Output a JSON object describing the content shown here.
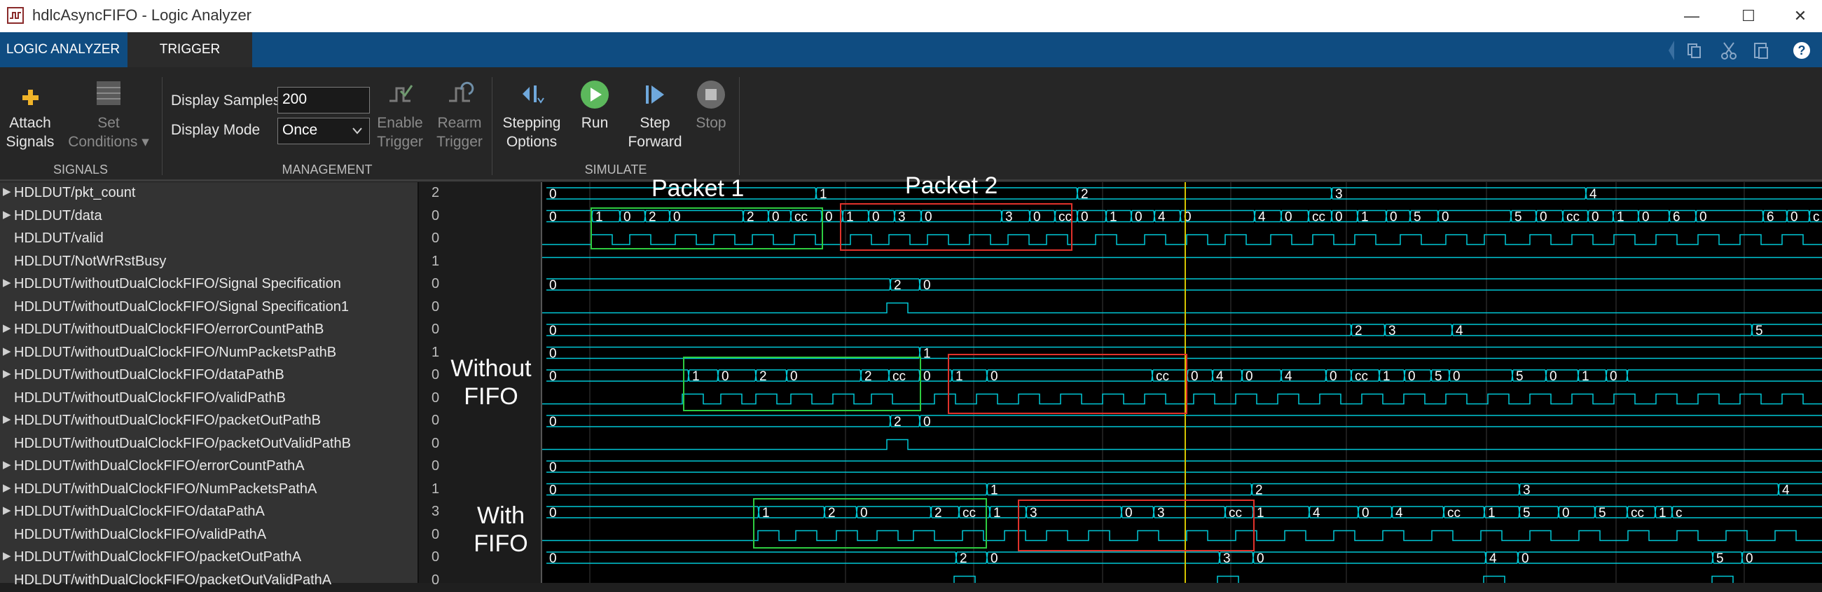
{
  "window": {
    "title": "hdlcAsyncFIFO - Logic Analyzer",
    "app_icon": "logic-analyzer-icon",
    "controls": [
      "minimize-icon",
      "maximize-icon",
      "close-icon"
    ],
    "minimize_glyph": "—",
    "maximize_glyph": "☐",
    "close_glyph": "✕"
  },
  "tabs": [
    {
      "label": "LOGIC ANALYZER",
      "active": false
    },
    {
      "label": "TRIGGER",
      "active": true
    }
  ],
  "quick_access": [
    "copy-icon",
    "cut-icon",
    "paste-icon",
    "help-icon"
  ],
  "toolstrip": {
    "signals": {
      "section_label": "SIGNALS",
      "attach": {
        "line1": "Attach",
        "line2": "Signals"
      },
      "set_conditions": {
        "line1": "Set",
        "line2": "Conditions ▾"
      }
    },
    "management": {
      "section_label": "MANAGEMENT",
      "display_samples_label": "Display Samples",
      "display_samples_value": "200",
      "display_mode_label": "Display Mode",
      "display_mode_value": "Once",
      "enable_trigger": {
        "line1": "Enable",
        "line2": "Trigger"
      },
      "rearm_trigger": {
        "line1": "Rearm",
        "line2": "Trigger"
      }
    },
    "simulate": {
      "section_label": "SIMULATE",
      "stepping": {
        "line1": "Stepping",
        "line2": "Options"
      },
      "run": {
        "line1": "Run"
      },
      "step_forward": {
        "line1": "Step",
        "line2": "Forward"
      },
      "stop": {
        "line1": "Stop"
      }
    }
  },
  "signals": [
    {
      "name": "HDLDUT/pkt_count",
      "value": "2",
      "expand": true
    },
    {
      "name": "HDLDUT/data",
      "value": "0",
      "expand": true
    },
    {
      "name": "HDLDUT/valid",
      "value": "0",
      "expand": false
    },
    {
      "name": "HDLDUT/NotWrRstBusy",
      "value": "1",
      "expand": false
    },
    {
      "name": "HDLDUT/withoutDualClockFIFO/Signal Specification",
      "value": "0",
      "expand": true
    },
    {
      "name": "HDLDUT/withoutDualClockFIFO/Signal Specification1",
      "value": "0",
      "expand": false
    },
    {
      "name": "HDLDUT/withoutDualClockFIFO/errorCountPathB",
      "value": "0",
      "expand": true
    },
    {
      "name": "HDLDUT/withoutDualClockFIFO/NumPacketsPathB",
      "value": "1",
      "expand": true
    },
    {
      "name": "HDLDUT/withoutDualClockFIFO/dataPathB",
      "value": "0",
      "expand": true
    },
    {
      "name": "HDLDUT/withoutDualClockFIFO/validPathB",
      "value": "0",
      "expand": false
    },
    {
      "name": "HDLDUT/withoutDualClockFIFO/packetOutPathB",
      "value": "0",
      "expand": true
    },
    {
      "name": "HDLDUT/withoutDualClockFIFO/packetOutValidPathB",
      "value": "0",
      "expand": false
    },
    {
      "name": "HDLDUT/withDualClockFIFO/errorCountPathA",
      "value": "0",
      "expand": true
    },
    {
      "name": "HDLDUT/withDualClockFIFO/NumPacketsPathA",
      "value": "1",
      "expand": true
    },
    {
      "name": "HDLDUT/withDualClockFIFO/dataPathA",
      "value": "3",
      "expand": true
    },
    {
      "name": "HDLDUT/withDualClockFIFO/validPathA",
      "value": "0",
      "expand": false
    },
    {
      "name": "HDLDUT/withDualClockFIFO/packetOutPathA",
      "value": "0",
      "expand": true
    },
    {
      "name": "HDLDUT/withDualClockFIFO/packetOutValidPathA",
      "value": "0",
      "expand": false
    }
  ],
  "overlays": {
    "packet1": "Packet 1",
    "packet2": "Packet 2",
    "without_fifo": {
      "line1": "Without",
      "line2": "FIFO"
    },
    "with_fifo": {
      "line1": "With",
      "line2": "FIFO"
    }
  },
  "colors": {
    "wave": "#00c8d6",
    "text": "#ffffff",
    "cursor": "#d4c400",
    "packet1_box": "#2ecc40",
    "packet2_box": "#e0322b",
    "grid": "#3a3a3a",
    "tabbar": "#0f4c81"
  },
  "waveforms": {
    "labels": [
      [
        "0",
        "1",
        "2",
        "3",
        "4"
      ],
      [
        "0",
        "1",
        "0",
        "2",
        "0",
        "2",
        "0",
        "cc",
        "0",
        "1",
        "0",
        "3",
        "0",
        "3",
        "0",
        "cc",
        "0",
        "1",
        "0",
        "4",
        "0",
        "4",
        "0",
        "cc",
        "0",
        "1",
        "0",
        "5",
        "0",
        "5",
        "0",
        "cc",
        "0",
        "1",
        "0",
        "6",
        "0",
        "6",
        "0",
        "c"
      ],
      [],
      [],
      [
        "0",
        "2",
        "0"
      ],
      [],
      [
        "0",
        "2",
        "3",
        "4",
        "5"
      ],
      [
        "0",
        "1"
      ],
      [
        "0",
        "1",
        "0",
        "2",
        "0",
        "2",
        "cc",
        "0",
        "1",
        "0",
        "cc",
        "0",
        "4",
        "0",
        "4",
        "0",
        "cc",
        "1",
        "0",
        "5",
        "0",
        "5",
        "0",
        "1",
        "0"
      ],
      [],
      [
        "0",
        "2",
        "0"
      ],
      [],
      [
        "0"
      ],
      [
        "0",
        "1",
        "2",
        "3",
        "4"
      ],
      [
        "0",
        "1",
        "2",
        "0",
        "2",
        "cc",
        "1",
        "3",
        "0",
        "3",
        "cc",
        "1",
        "4",
        "0",
        "4",
        "cc",
        "1",
        "5",
        "0",
        "5",
        "cc",
        "1",
        "c"
      ],
      [],
      [
        "0",
        "2",
        "0",
        "3",
        "0",
        "4",
        "0",
        "5",
        "0"
      ],
      []
    ]
  }
}
